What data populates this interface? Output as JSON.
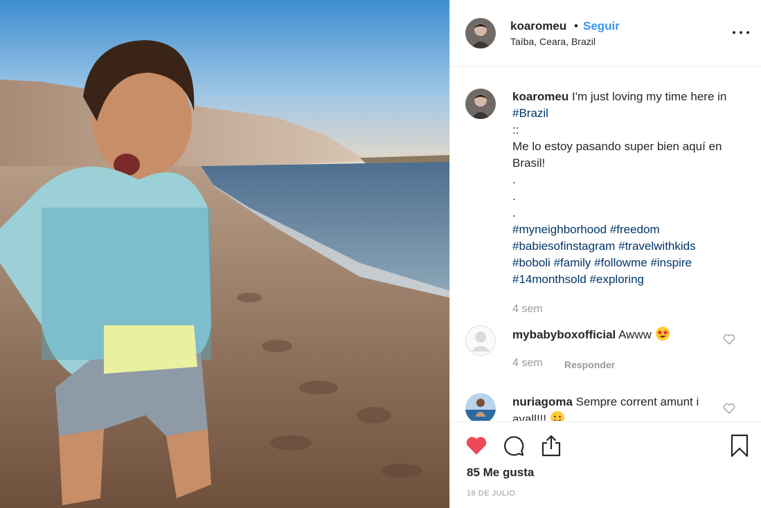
{
  "post": {
    "username": "koaromeu",
    "separator": "•",
    "follow_label": "Seguir",
    "location": "Taíba, Ceara, Brazil"
  },
  "caption": {
    "username": "koaromeu",
    "text_1": "I'm just loving my time here in",
    "hashtag_brazil": "#Brazil",
    "line_sep": "::",
    "line_es": "Me lo estoy pasando super bien aquí en Brasil!",
    "dot": ".",
    "hashtags": [
      "#myneighborhood",
      "#freedom",
      "#babiesofinstagram",
      "#travelwithkids",
      "#boboli",
      "#family",
      "#followme",
      "#inspire",
      "#14monthsold",
      "#exploring"
    ],
    "time": "4 sem"
  },
  "comments": [
    {
      "username": "mybabyboxofficial",
      "text": "Awww",
      "emoji": "star-struck-emoji",
      "time": "4 sem",
      "reply_label": "Responder"
    },
    {
      "username": "nuriagoma",
      "text": "Sempre corrent amunt i avall!!!",
      "emoji": "smiling-emoji"
    }
  ],
  "actions": {
    "likes": "85 Me gusta",
    "date": "16 DE JULIO",
    "liked": true
  },
  "colors": {
    "link": "#3897f0",
    "hashtag": "#003569",
    "like": "#ed4956",
    "muted": "#999999",
    "border": "#efefef"
  }
}
